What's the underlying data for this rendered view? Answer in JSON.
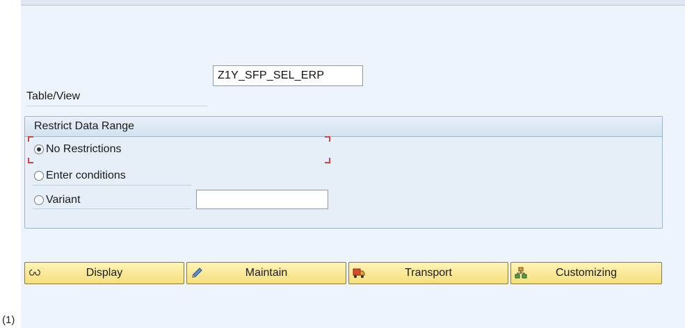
{
  "page_marker": "(1)",
  "table_view": {
    "label": "Table/View",
    "value": "Z1Y_SFP_SEL_ERP"
  },
  "restrict_group": {
    "title": "Restrict Data Range",
    "options": [
      {
        "label": "No Restrictions",
        "selected": true
      },
      {
        "label": "Enter conditions",
        "selected": false
      },
      {
        "label": "Variant",
        "selected": false
      }
    ],
    "variant_value": ""
  },
  "buttons": [
    {
      "label": "Display",
      "icon": "glasses-icon"
    },
    {
      "label": "Maintain",
      "icon": "pencil-icon"
    },
    {
      "label": "Transport",
      "icon": "truck-icon"
    },
    {
      "label": "Customizing",
      "icon": "hierarchy-icon"
    }
  ],
  "colors": {
    "background": "#eef4fb",
    "button": "#f6df7a",
    "focus": "#d94040"
  }
}
